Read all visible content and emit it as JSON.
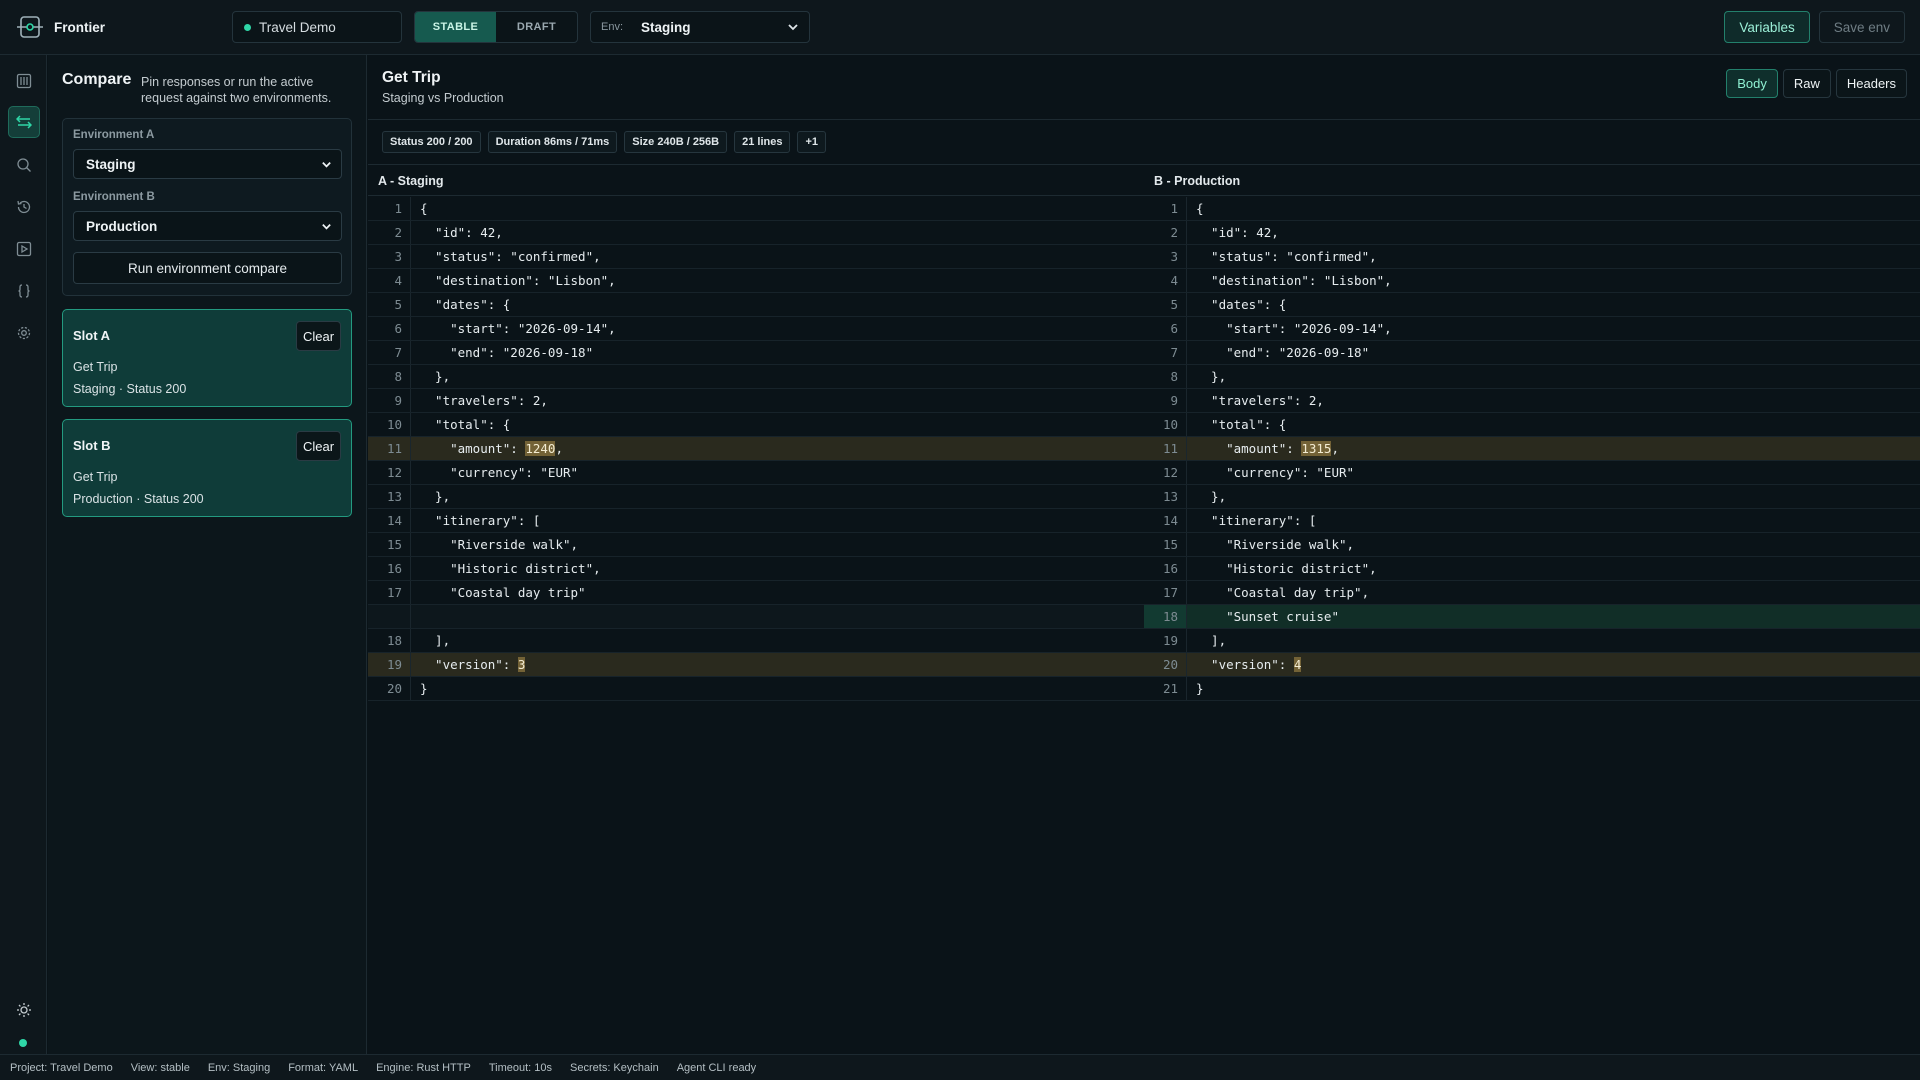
{
  "app": {
    "name": "Frontier",
    "project": "Travel Demo",
    "mode_tabs": [
      {
        "label": "STABLE",
        "active": true
      },
      {
        "label": "DRAFT",
        "active": false
      }
    ],
    "env_label": "Env:",
    "env_value": "Staging",
    "variables_label": "Variables",
    "save_env_label": "Save env",
    "accent_color": "#2fd7a7"
  },
  "rail": {
    "icons": [
      "collections-icon",
      "compare-icon",
      "search-icon",
      "history-icon",
      "runner-icon",
      "code-icon",
      "settings-icon"
    ],
    "bottom_icon": "theme-icon"
  },
  "compare_panel": {
    "title": "Compare",
    "description": "Pin responses or run the active request against two environments.",
    "env_a_label": "Environment A",
    "env_a_value": "Staging",
    "env_b_label": "Environment B",
    "env_b_value": "Production",
    "run_label": "Run environment compare",
    "slots": [
      {
        "title": "Slot A",
        "clear_label": "Clear",
        "request": "Get Trip",
        "meta": "Staging · Status 200"
      },
      {
        "title": "Slot B",
        "clear_label": "Clear",
        "request": "Get Trip",
        "meta": "Production · Status 200"
      }
    ]
  },
  "main": {
    "title": "Get Trip",
    "subtitle": "Staging vs Production",
    "view_tabs": [
      {
        "label": "Body",
        "active": true
      },
      {
        "label": "Raw",
        "active": false
      },
      {
        "label": "Headers",
        "active": false
      }
    ],
    "badges": [
      "Status 200 / 200",
      "Duration 86ms / 71ms",
      "Size 240B / 256B",
      "21 lines",
      "+1"
    ],
    "left_header": "A - Staging",
    "right_header": "B - Production"
  },
  "diff": {
    "left": [
      {
        "n": "1",
        "t": "{"
      },
      {
        "n": "2",
        "t": "  \"id\": 42,"
      },
      {
        "n": "3",
        "t": "  \"status\": \"confirmed\","
      },
      {
        "n": "4",
        "t": "  \"destination\": \"Lisbon\","
      },
      {
        "n": "5",
        "t": "  \"dates\": {"
      },
      {
        "n": "6",
        "t": "    \"start\": \"2026-09-14\","
      },
      {
        "n": "7",
        "t": "    \"end\": \"2026-09-18\""
      },
      {
        "n": "8",
        "t": "  },"
      },
      {
        "n": "9",
        "t": "  \"travelers\": 2,"
      },
      {
        "n": "10",
        "t": "  \"total\": {"
      },
      {
        "n": "11",
        "pre": "    \"amount\": ",
        "hl": "1240",
        "post": ",",
        "kind": "changed"
      },
      {
        "n": "12",
        "t": "    \"currency\": \"EUR\""
      },
      {
        "n": "13",
        "t": "  },"
      },
      {
        "n": "14",
        "t": "  \"itinerary\": ["
      },
      {
        "n": "15",
        "t": "    \"Riverside walk\","
      },
      {
        "n": "16",
        "t": "    \"Historic district\","
      },
      {
        "n": "17",
        "t": "    \"Coastal day trip\""
      },
      {
        "n": "",
        "t": "",
        "kind": "blank"
      },
      {
        "n": "18",
        "t": "  ],"
      },
      {
        "n": "19",
        "pre": "  \"version\": ",
        "hl": "3",
        "post": "",
        "kind": "changed"
      },
      {
        "n": "20",
        "t": "}"
      }
    ],
    "right": [
      {
        "n": "1",
        "t": "{"
      },
      {
        "n": "2",
        "t": "  \"id\": 42,"
      },
      {
        "n": "3",
        "t": "  \"status\": \"confirmed\","
      },
      {
        "n": "4",
        "t": "  \"destination\": \"Lisbon\","
      },
      {
        "n": "5",
        "t": "  \"dates\": {"
      },
      {
        "n": "6",
        "t": "    \"start\": \"2026-09-14\","
      },
      {
        "n": "7",
        "t": "    \"end\": \"2026-09-18\""
      },
      {
        "n": "8",
        "t": "  },"
      },
      {
        "n": "9",
        "t": "  \"travelers\": 2,"
      },
      {
        "n": "10",
        "t": "  \"total\": {"
      },
      {
        "n": "11",
        "pre": "    \"amount\": ",
        "hl": "1315",
        "post": ",",
        "kind": "changed"
      },
      {
        "n": "12",
        "t": "    \"currency\": \"EUR\""
      },
      {
        "n": "13",
        "t": "  },"
      },
      {
        "n": "14",
        "t": "  \"itinerary\": ["
      },
      {
        "n": "15",
        "t": "    \"Riverside walk\","
      },
      {
        "n": "16",
        "t": "    \"Historic district\","
      },
      {
        "n": "17",
        "t": "    \"Coastal day trip\","
      },
      {
        "n": "18",
        "t": "    \"Sunset cruise\"",
        "kind": "added"
      },
      {
        "n": "19",
        "t": "  ],"
      },
      {
        "n": "20",
        "pre": "  \"version\": ",
        "hl": "4",
        "post": "",
        "kind": "changed"
      },
      {
        "n": "21",
        "t": "}"
      }
    ]
  },
  "statusbar": [
    "Project: Travel Demo",
    "View: stable",
    "Env: Staging",
    "Format: YAML",
    "Engine: Rust HTTP",
    "Timeout: 10s",
    "Secrets: Keychain",
    "Agent CLI ready"
  ]
}
